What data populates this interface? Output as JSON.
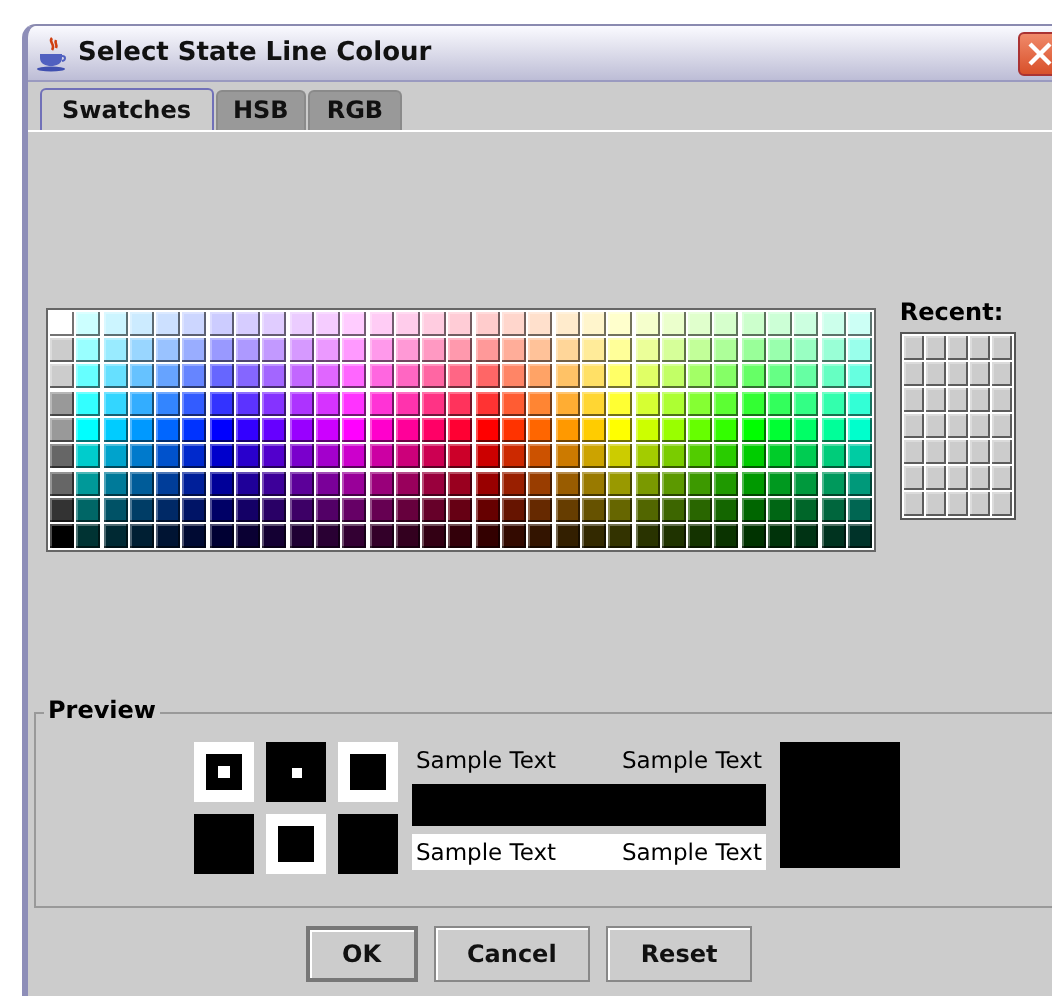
{
  "window": {
    "title": "Select State Line Colour"
  },
  "tabs": [
    {
      "label": "Swatches",
      "selected": true
    },
    {
      "label": "HSB",
      "selected": false
    },
    {
      "label": "RGB",
      "selected": false
    }
  ],
  "recent": {
    "label": "Recent:"
  },
  "preview": {
    "title": "Preview",
    "color": "#000000",
    "samples_top": [
      "Sample Text",
      "Sample Text"
    ],
    "samples_bottom": [
      "Sample Text",
      "Sample Text"
    ]
  },
  "buttons": [
    {
      "label": "OK",
      "default": true
    },
    {
      "label": "Cancel",
      "default": false
    },
    {
      "label": "Reset",
      "default": false
    }
  ]
}
